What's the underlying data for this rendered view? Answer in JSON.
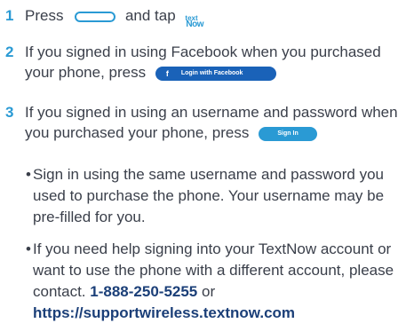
{
  "steps": [
    {
      "number": "1",
      "text_before": "Press",
      "text_after": "and tap",
      "app_icon_line1": "text",
      "app_icon_line2": "Now"
    },
    {
      "number": "2",
      "text": "If you signed in using Facebook when you purchased your phone, press",
      "button_icon": "f",
      "button_label": "Login with Facebook"
    },
    {
      "number": "3",
      "text": "If you signed in using an username and password when you purchased your phone, press",
      "button_label": "Sign In"
    }
  ],
  "bullets": [
    {
      "marker": "•",
      "text": "Sign in using the same username and password you used to purchase the phone. Your username may be pre-filled for you."
    },
    {
      "marker": "•",
      "text": "If you need help signing into your TextNow account or want to use the phone with a different account, please contact.",
      "phone": "1-888-250-5255",
      "connector": "or",
      "url": "https://supportwireless.textnow.com"
    }
  ],
  "colors": {
    "accent": "#2a9ad4",
    "facebook": "#1a62b8",
    "text": "#3a3f4a",
    "strong": "#1b3f78"
  },
  "icons": {
    "home_button": "home-button-icon",
    "app": "textnow-app-icon",
    "facebook": "facebook-f-icon"
  }
}
